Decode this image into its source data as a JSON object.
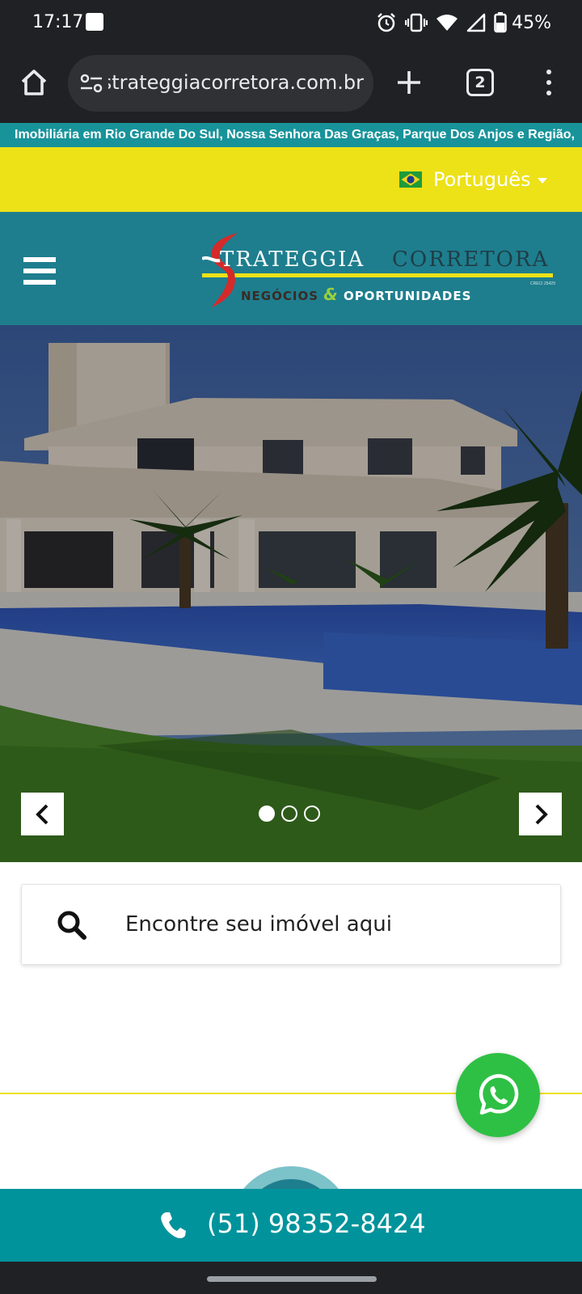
{
  "status_bar": {
    "time": "17:17",
    "battery_percent": "45%",
    "icons": [
      "notification-square-icon",
      "alarm-icon",
      "vibrate-icon",
      "wifi-icon",
      "signal-icon",
      "battery-icon"
    ]
  },
  "browser": {
    "url": "strateggiacorretora.com.br",
    "tab_count": "2",
    "icons": [
      "home-icon",
      "site-settings-icon",
      "new-tab-icon",
      "tab-switcher-icon",
      "more-menu-icon"
    ]
  },
  "ticker": {
    "text": "Imobiliária em Rio Grande Do Sul, Nossa Senhora Das Graças, Parque Dos Anjos e Região,"
  },
  "language": {
    "selected": "Português",
    "flag": "brazil-flag-icon"
  },
  "header": {
    "logo": {
      "word1": "TRATEGGIA",
      "word2": "CORRETORA",
      "tagline_left": "NEGÓCIOS",
      "tagline_amp": "&",
      "tagline_right": "OPORTUNIDADES",
      "registry": "CRECI 25429"
    }
  },
  "hero": {
    "slide_count": 3,
    "active_slide": 1
  },
  "search": {
    "placeholder": "Encontre seu imóvel aqui"
  },
  "contact": {
    "phone": "(51) 98352-8424"
  },
  "colors": {
    "teal_header": "#1e7e8e",
    "teal_bar": "#00939b",
    "yellow": "#ede118",
    "whatsapp_green": "#2ec044",
    "logo_red": "#d42a2a"
  }
}
